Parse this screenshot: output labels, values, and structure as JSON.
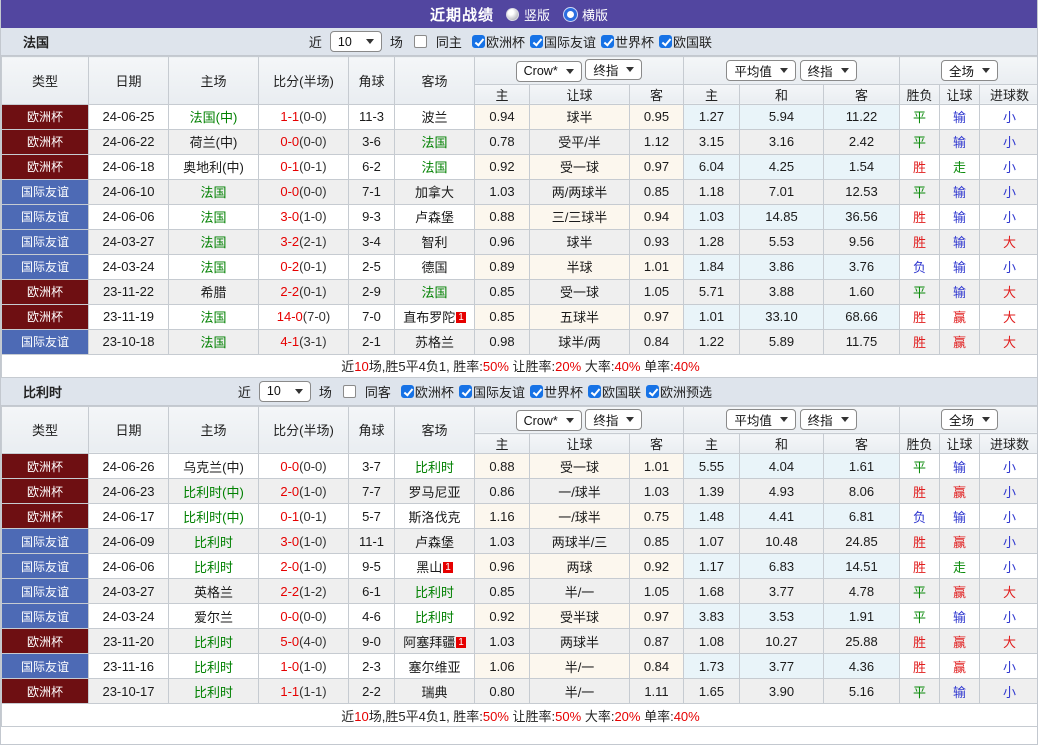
{
  "title_bar": {
    "title": "近期战绩",
    "radio_vertical": "竖版",
    "radio_horizontal": "横版"
  },
  "controls": {
    "near_label": "近",
    "games_label": "场"
  },
  "selects": {
    "bookmaker": "Crow*",
    "final_index": "终指",
    "average": "平均值",
    "full_match": "全场"
  },
  "columns": {
    "type": "类型",
    "date": "日期",
    "home": "主场",
    "score_half": "比分(半场)",
    "corner": "角球",
    "away": "客场",
    "odds_home": "主",
    "handicap": "让球",
    "odds_away": "客",
    "avg_home": "主",
    "avg_draw": "和",
    "avg_away": "客",
    "result_wdl": "胜负",
    "result_handicap": "让球",
    "result_goals": "进球数"
  },
  "colors": {
    "accent_purple": "#5246a0",
    "type_euro_bg": "#6e0f12",
    "type_friendly_bg": "#4d6ab5",
    "team_highlight": "#008000",
    "score_red": "#e60000",
    "result_red": "#e11d1d",
    "result_green": "#0a8a0a",
    "result_blue": "#3038d0",
    "checkbox_blue": "#1672e6"
  },
  "result_color_map": {
    "胜": "red",
    "平": "green",
    "负": "blue",
    "输": "blue",
    "赢": "red",
    "走": "green",
    "大": "red",
    "小": "blue"
  },
  "sections": [
    {
      "team": "法国",
      "near_count": "10",
      "same_label": "同主",
      "filters": [
        "欧洲杯",
        "国际友谊",
        "世界杯",
        "欧国联"
      ],
      "rows": [
        {
          "type": "欧洲杯",
          "date": "24-06-25",
          "home": "法国(中)",
          "home_focus": true,
          "score": "1-1",
          "half": "(0-0)",
          "corner": "11-3",
          "away": "波兰",
          "away_focus": false,
          "odds": [
            "0.94",
            "球半",
            "0.95"
          ],
          "avg": [
            "1.27",
            "5.94",
            "11.22"
          ],
          "results": [
            "平",
            "输",
            "小"
          ]
        },
        {
          "type": "欧洲杯",
          "date": "24-06-22",
          "home": "荷兰(中)",
          "home_focus": false,
          "score": "0-0",
          "half": "(0-0)",
          "corner": "3-6",
          "away": "法国",
          "away_focus": true,
          "odds": [
            "0.78",
            "受平/半",
            "1.12"
          ],
          "avg": [
            "3.15",
            "3.16",
            "2.42"
          ],
          "results": [
            "平",
            "输",
            "小"
          ]
        },
        {
          "type": "欧洲杯",
          "date": "24-06-18",
          "home": "奥地利(中)",
          "home_focus": false,
          "score": "0-1",
          "half": "(0-1)",
          "corner": "6-2",
          "away": "法国",
          "away_focus": true,
          "odds": [
            "0.92",
            "受一球",
            "0.97"
          ],
          "avg": [
            "6.04",
            "4.25",
            "1.54"
          ],
          "results": [
            "胜",
            "走",
            "小"
          ]
        },
        {
          "type": "国际友谊",
          "date": "24-06-10",
          "home": "法国",
          "home_focus": true,
          "score": "0-0",
          "half": "(0-0)",
          "corner": "7-1",
          "away": "加拿大",
          "away_focus": false,
          "odds": [
            "1.03",
            "两/两球半",
            "0.85"
          ],
          "avg": [
            "1.18",
            "7.01",
            "12.53"
          ],
          "results": [
            "平",
            "输",
            "小"
          ]
        },
        {
          "type": "国际友谊",
          "date": "24-06-06",
          "home": "法国",
          "home_focus": true,
          "score": "3-0",
          "half": "(1-0)",
          "corner": "9-3",
          "away": "卢森堡",
          "away_focus": false,
          "odds": [
            "0.88",
            "三/三球半",
            "0.94"
          ],
          "avg": [
            "1.03",
            "14.85",
            "36.56"
          ],
          "results": [
            "胜",
            "输",
            "小"
          ]
        },
        {
          "type": "国际友谊",
          "date": "24-03-27",
          "home": "法国",
          "home_focus": true,
          "score": "3-2",
          "half": "(2-1)",
          "corner": "3-4",
          "away": "智利",
          "away_focus": false,
          "odds": [
            "0.96",
            "球半",
            "0.93"
          ],
          "avg": [
            "1.28",
            "5.53",
            "9.56"
          ],
          "results": [
            "胜",
            "输",
            "大"
          ]
        },
        {
          "type": "国际友谊",
          "date": "24-03-24",
          "home": "法国",
          "home_focus": true,
          "score": "0-2",
          "half": "(0-1)",
          "corner": "2-5",
          "away": "德国",
          "away_focus": false,
          "odds": [
            "0.89",
            "半球",
            "1.01"
          ],
          "avg": [
            "1.84",
            "3.86",
            "3.76"
          ],
          "results": [
            "负",
            "输",
            "小"
          ]
        },
        {
          "type": "欧洲杯",
          "date": "23-11-22",
          "home": "希腊",
          "home_focus": false,
          "score": "2-2",
          "half": "(0-1)",
          "corner": "2-9",
          "away": "法国",
          "away_focus": true,
          "odds": [
            "0.85",
            "受一球",
            "1.05"
          ],
          "avg": [
            "5.71",
            "3.88",
            "1.60"
          ],
          "results": [
            "平",
            "输",
            "大"
          ]
        },
        {
          "type": "欧洲杯",
          "date": "23-11-19",
          "home": "法国",
          "home_focus": true,
          "score": "14-0",
          "half": "(7-0)",
          "corner": "7-0",
          "away": "直布罗陀",
          "away_focus": false,
          "away_card": "1",
          "odds": [
            "0.85",
            "五球半",
            "0.97"
          ],
          "avg": [
            "1.01",
            "33.10",
            "68.66"
          ],
          "results": [
            "胜",
            "赢",
            "大"
          ]
        },
        {
          "type": "国际友谊",
          "date": "23-10-18",
          "home": "法国",
          "home_focus": true,
          "score": "4-1",
          "half": "(3-1)",
          "corner": "2-1",
          "away": "苏格兰",
          "away_focus": false,
          "odds": [
            "0.98",
            "球半/两",
            "0.84"
          ],
          "avg": [
            "1.22",
            "5.89",
            "11.75"
          ],
          "results": [
            "胜",
            "赢",
            "大"
          ]
        }
      ],
      "summary": [
        {
          "t": "近"
        },
        {
          "t": "10",
          "red": true
        },
        {
          "t": "场,胜5平4负1, 胜率:"
        },
        {
          "t": "50%",
          "red": true
        },
        {
          "t": " 让胜率:"
        },
        {
          "t": "20%",
          "red": true
        },
        {
          "t": " 大率:"
        },
        {
          "t": "40%",
          "red": true
        },
        {
          "t": " 单率:"
        },
        {
          "t": "40%",
          "red": true
        }
      ]
    },
    {
      "team": "比利时",
      "near_count": "10",
      "same_label": "同客",
      "filters": [
        "欧洲杯",
        "国际友谊",
        "世界杯",
        "欧国联",
        "欧洲预选"
      ],
      "rows": [
        {
          "type": "欧洲杯",
          "date": "24-06-26",
          "home": "乌克兰(中)",
          "home_focus": false,
          "score": "0-0",
          "half": "(0-0)",
          "corner": "3-7",
          "away": "比利时",
          "away_focus": true,
          "odds": [
            "0.88",
            "受一球",
            "1.01"
          ],
          "avg": [
            "5.55",
            "4.04",
            "1.61"
          ],
          "results": [
            "平",
            "输",
            "小"
          ]
        },
        {
          "type": "欧洲杯",
          "date": "24-06-23",
          "home": "比利时(中)",
          "home_focus": true,
          "score": "2-0",
          "half": "(1-0)",
          "corner": "7-7",
          "away": "罗马尼亚",
          "away_focus": false,
          "odds": [
            "0.86",
            "一/球半",
            "1.03"
          ],
          "avg": [
            "1.39",
            "4.93",
            "8.06"
          ],
          "results": [
            "胜",
            "赢",
            "小"
          ]
        },
        {
          "type": "欧洲杯",
          "date": "24-06-17",
          "home": "比利时(中)",
          "home_focus": true,
          "score": "0-1",
          "half": "(0-1)",
          "corner": "5-7",
          "away": "斯洛伐克",
          "away_focus": false,
          "odds": [
            "1.16",
            "一/球半",
            "0.75"
          ],
          "avg": [
            "1.48",
            "4.41",
            "6.81"
          ],
          "results": [
            "负",
            "输",
            "小"
          ]
        },
        {
          "type": "国际友谊",
          "date": "24-06-09",
          "home": "比利时",
          "home_focus": true,
          "score": "3-0",
          "half": "(1-0)",
          "corner": "11-1",
          "away": "卢森堡",
          "away_focus": false,
          "odds": [
            "1.03",
            "两球半/三",
            "0.85"
          ],
          "avg": [
            "1.07",
            "10.48",
            "24.85"
          ],
          "results": [
            "胜",
            "赢",
            "小"
          ]
        },
        {
          "type": "国际友谊",
          "date": "24-06-06",
          "home": "比利时",
          "home_focus": true,
          "score": "2-0",
          "half": "(1-0)",
          "corner": "9-5",
          "away": "黑山",
          "away_focus": false,
          "away_card": "1",
          "odds": [
            "0.96",
            "两球",
            "0.92"
          ],
          "avg": [
            "1.17",
            "6.83",
            "14.51"
          ],
          "results": [
            "胜",
            "走",
            "小"
          ]
        },
        {
          "type": "国际友谊",
          "date": "24-03-27",
          "home": "英格兰",
          "home_focus": false,
          "score": "2-2",
          "half": "(1-2)",
          "corner": "6-1",
          "away": "比利时",
          "away_focus": true,
          "odds": [
            "0.85",
            "半/一",
            "1.05"
          ],
          "avg": [
            "1.68",
            "3.77",
            "4.78"
          ],
          "results": [
            "平",
            "赢",
            "大"
          ]
        },
        {
          "type": "国际友谊",
          "date": "24-03-24",
          "home": "爱尔兰",
          "home_focus": false,
          "score": "0-0",
          "half": "(0-0)",
          "corner": "4-6",
          "away": "比利时",
          "away_focus": true,
          "odds": [
            "0.92",
            "受半球",
            "0.97"
          ],
          "avg": [
            "3.83",
            "3.53",
            "1.91"
          ],
          "results": [
            "平",
            "输",
            "小"
          ]
        },
        {
          "type": "欧洲杯",
          "date": "23-11-20",
          "home": "比利时",
          "home_focus": true,
          "score": "5-0",
          "half": "(4-0)",
          "corner": "9-0",
          "away": "阿塞拜疆",
          "away_focus": false,
          "away_card": "1",
          "odds": [
            "1.03",
            "两球半",
            "0.87"
          ],
          "avg": [
            "1.08",
            "10.27",
            "25.88"
          ],
          "results": [
            "胜",
            "赢",
            "大"
          ]
        },
        {
          "type": "国际友谊",
          "date": "23-11-16",
          "home": "比利时",
          "home_focus": true,
          "score": "1-0",
          "half": "(1-0)",
          "corner": "2-3",
          "away": "塞尔维亚",
          "away_focus": false,
          "odds": [
            "1.06",
            "半/一",
            "0.84"
          ],
          "avg": [
            "1.73",
            "3.77",
            "4.36"
          ],
          "results": [
            "胜",
            "赢",
            "小"
          ]
        },
        {
          "type": "欧洲杯",
          "date": "23-10-17",
          "home": "比利时",
          "home_focus": true,
          "score": "1-1",
          "half": "(1-1)",
          "corner": "2-2",
          "away": "瑞典",
          "away_focus": false,
          "odds": [
            "0.80",
            "半/一",
            "1.11"
          ],
          "avg": [
            "1.65",
            "3.90",
            "5.16"
          ],
          "results": [
            "平",
            "输",
            "小"
          ]
        }
      ],
      "summary": [
        {
          "t": "近"
        },
        {
          "t": "10",
          "red": true
        },
        {
          "t": "场,胜5平4负1, 胜率:"
        },
        {
          "t": "50%",
          "red": true
        },
        {
          "t": " 让胜率:"
        },
        {
          "t": "50%",
          "red": true
        },
        {
          "t": " 大率:"
        },
        {
          "t": "20%",
          "red": true
        },
        {
          "t": " 单率:"
        },
        {
          "t": "40%",
          "red": true
        }
      ]
    }
  ]
}
